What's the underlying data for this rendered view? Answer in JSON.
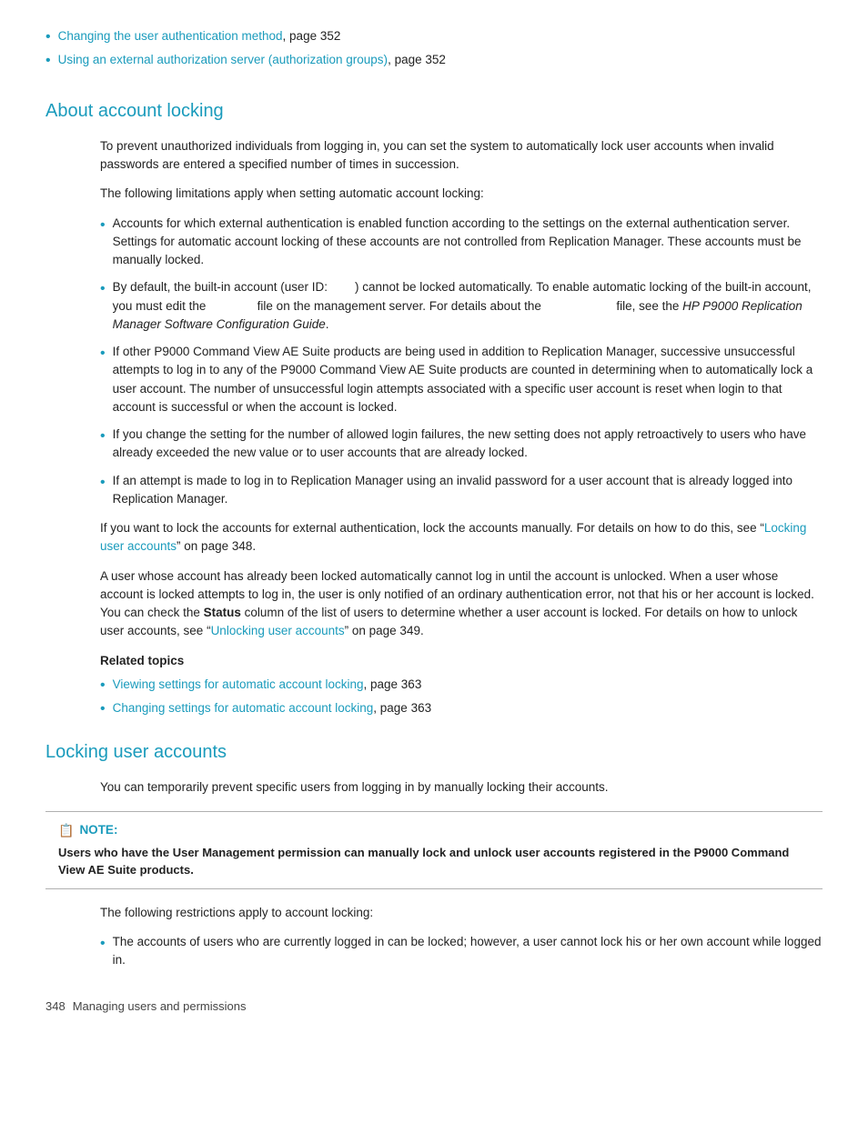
{
  "top_links": [
    {
      "text": "Changing the user authentication method",
      "suffix": ", page 352"
    },
    {
      "text": "Using an external authorization server (authorization groups)",
      "suffix": ", page 352"
    }
  ],
  "about_section": {
    "heading": "About account locking",
    "intro_paragraph": "To prevent unauthorized individuals from logging in, you can set the system to automatically lock user accounts when invalid passwords are entered a specified number of times in succession.",
    "limitations_intro": "The following limitations apply when setting automatic account locking:",
    "bullet_items": [
      "Accounts for which external authentication is enabled function according to the settings on the external authentication server. Settings for automatic account locking of these accounts are not controlled from Replication Manager. These accounts must be manually locked.",
      "By default, the built-in account (user ID:        ) cannot be locked automatically. To enable automatic locking of the built-in account, you must edit the              file on the management server. For details about the                    file, see the HP P9000 Replication Manager Software Configuration Guide.",
      "If other P9000 Command View AE Suite products are being used in addition to Replication Manager, successive unsuccessful attempts to log in to any of the P9000 Command View AE Suite products are counted in determining when to automatically lock a user account. The number of unsuccessful login attempts associated with a specific user account is reset when login to that account is successful or when the account is locked.",
      "If you change the setting for the number of allowed login failures, the new setting does not apply retroactively to users who have already exceeded the new value or to user accounts that are already locked.",
      "If an attempt is made to log in to Replication Manager using an invalid password for a user account that is already logged into Replication Manager."
    ],
    "para_external_auth": "If you want to lock the accounts for external authentication, lock the accounts manually. For details on how to do this, see “Locking user accounts” on page 348.",
    "para_locked_user": "A user whose account has already been locked automatically cannot log in until the account is unlocked. When a user whose account is locked attempts to log in, the user is only notified of an ordinary authentication error, not that his or her account is locked.  You can check the Status column of the list of users to determine whether a user account is locked. For details on how to unlock user accounts, see “Unlocking user accounts” on page 349.",
    "para_external_auth_link": "Locking user accounts",
    "para_unlock_link": "Unlocking user accounts",
    "related_topics_label": "Related topics",
    "related_topics": [
      {
        "text": "Viewing settings for automatic account locking",
        "suffix": ", page 363"
      },
      {
        "text": "Changing settings for automatic account locking",
        "suffix": ", page 363"
      }
    ]
  },
  "locking_section": {
    "heading": "Locking user accounts",
    "intro": "You can temporarily prevent specific users from logging in by manually locking their accounts.",
    "note_label": "NOTE:",
    "note_text": "Users who have the User Management permission can manually lock and unlock user accounts registered in the P9000 Command View AE Suite products.",
    "restrictions_intro": "The following restrictions apply to account locking:",
    "bullet_items": [
      "The accounts of users who are currently logged in can be locked; however, a user cannot lock his or her own account while logged in."
    ]
  },
  "footer": {
    "page_number": "348",
    "text": "Managing users and permissions"
  },
  "status_word": "Status"
}
